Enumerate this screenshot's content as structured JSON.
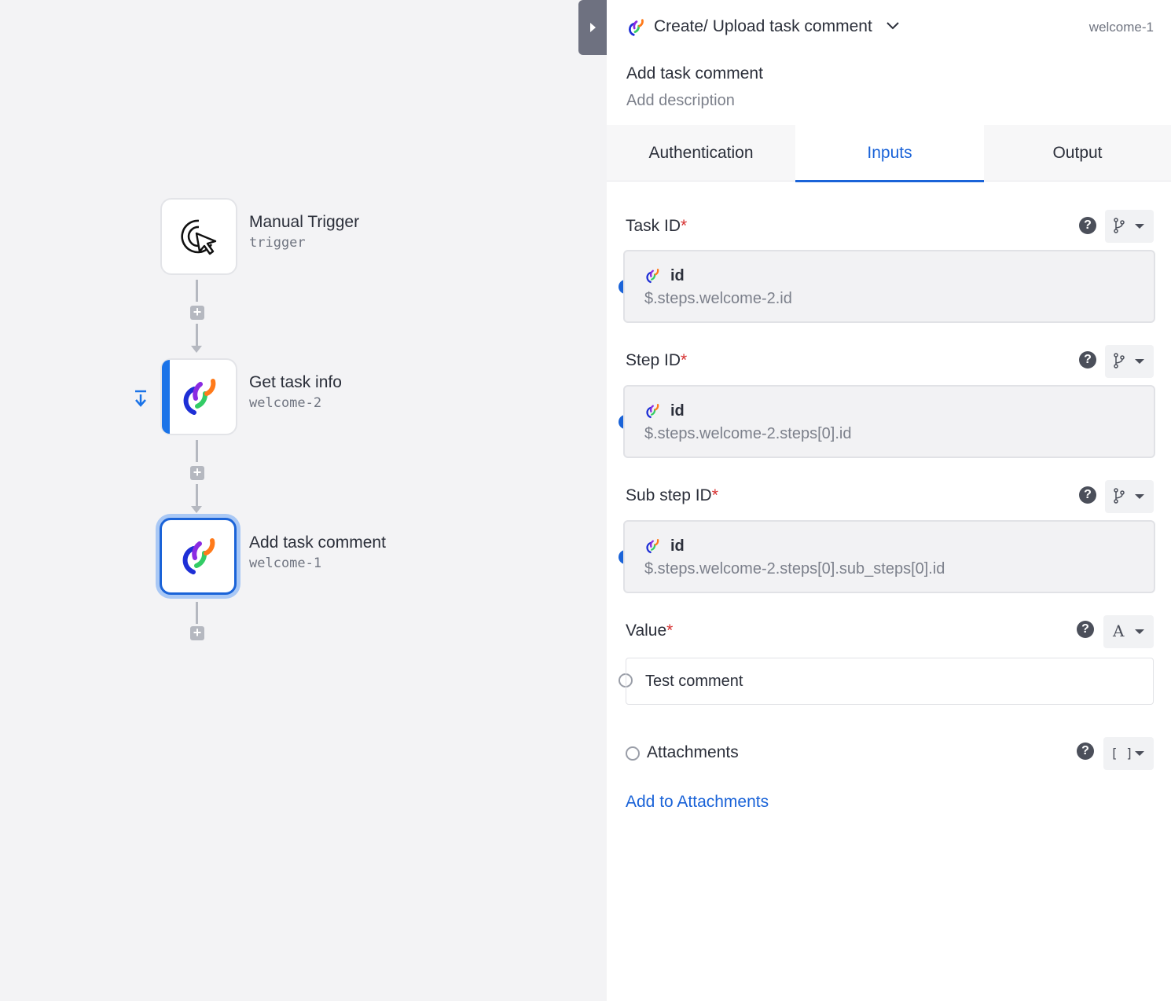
{
  "canvas": {
    "nodes": [
      {
        "title": "Manual Trigger",
        "subtitle": "trigger",
        "icon": "cursor-click-icon"
      },
      {
        "title": "Get task info",
        "subtitle": "welcome-2",
        "icon": "brand-logo-icon"
      },
      {
        "title": "Add task comment",
        "subtitle": "welcome-1",
        "icon": "brand-logo-icon",
        "selected": true
      }
    ],
    "add_symbol": "+"
  },
  "panel": {
    "header": {
      "title": "Create/ Upload task comment",
      "step_key": "welcome-1"
    },
    "step_name": "Add task comment",
    "step_description_placeholder": "Add description",
    "tabs": [
      {
        "label": "Authentication",
        "active": false
      },
      {
        "label": "Inputs",
        "active": true
      },
      {
        "label": "Output",
        "active": false
      }
    ],
    "fields": {
      "task_id": {
        "label": "Task ID",
        "required": "*",
        "ref_name": "id",
        "ref_path": "$.steps.welcome-2.id"
      },
      "step_id": {
        "label": "Step ID",
        "required": "*",
        "ref_name": "id",
        "ref_path": "$.steps.welcome-2.steps[0].id"
      },
      "sub_step_id": {
        "label": "Sub step ID",
        "required": "*",
        "ref_name": "id",
        "ref_path": "$.steps.welcome-2.steps[0].sub_steps[0].id"
      },
      "value": {
        "label": "Value",
        "required": "*",
        "value": "Test comment",
        "type_glyph": "A"
      },
      "attachments": {
        "label": "Attachments",
        "type_glyph": "[ ]",
        "add_label": "Add to Attachments"
      }
    },
    "help_glyph": "?"
  },
  "colors": {
    "accent": "#1a63d8",
    "required": "#d62f2f",
    "canvas_bg": "#f3f3f5"
  }
}
